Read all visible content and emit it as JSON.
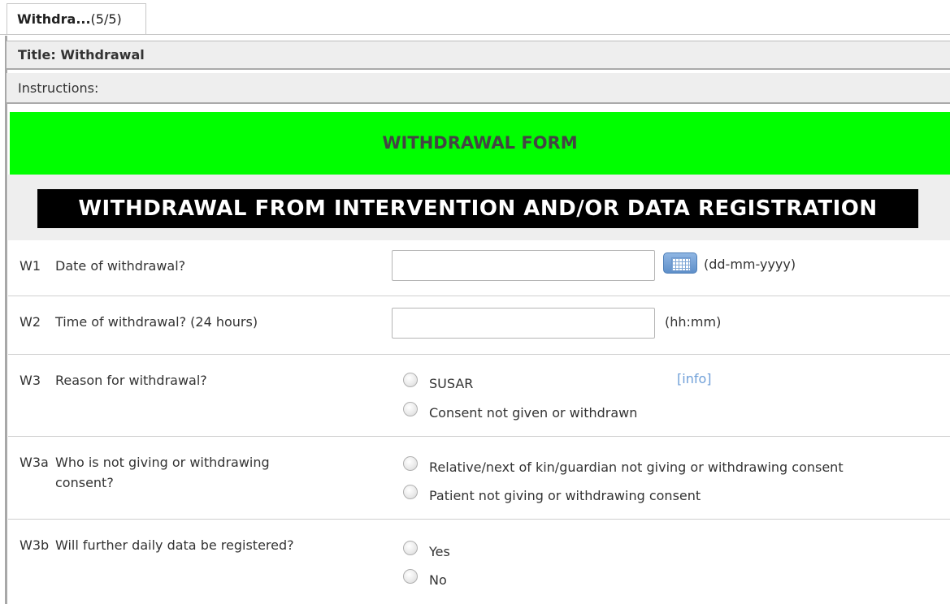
{
  "tab": {
    "name": "Withdra...",
    "count": "(5/5)"
  },
  "form": {
    "title": "Title: Withdrawal",
    "instructions": "Instructions:",
    "banner": "WITHDRAWAL FORM",
    "section": "WITHDRAWAL FROM INTERVENTION AND/OR DATA REGISTRATION"
  },
  "questions": {
    "w1": {
      "num": "W1",
      "text": "Date of withdrawal?",
      "value": "",
      "hint": "(dd-mm-yyyy)",
      "icon": "calendar-icon"
    },
    "w2": {
      "num": "W2",
      "text": "Time of withdrawal? (24 hours)",
      "value": "",
      "hint": "(hh:mm)"
    },
    "w3": {
      "num": "W3",
      "text": "Reason for withdrawal?",
      "info": "[info]",
      "options": [
        "SUSAR",
        "Consent not given or withdrawn"
      ]
    },
    "w3a": {
      "num": "W3a",
      "text_line1": "Who is not giving or withdrawing",
      "text_line2": "consent?",
      "options": [
        "Relative/next of kin/guardian not giving or withdrawing consent",
        "Patient not giving or withdrawing consent"
      ]
    },
    "w3b": {
      "num": "W3b",
      "text": "Will further daily data be registered?",
      "options": [
        "Yes",
        "No"
      ]
    }
  },
  "colors": {
    "banner_green": "#00ff00",
    "section_black": "#000000",
    "link_blue": "#6f9fd8"
  }
}
